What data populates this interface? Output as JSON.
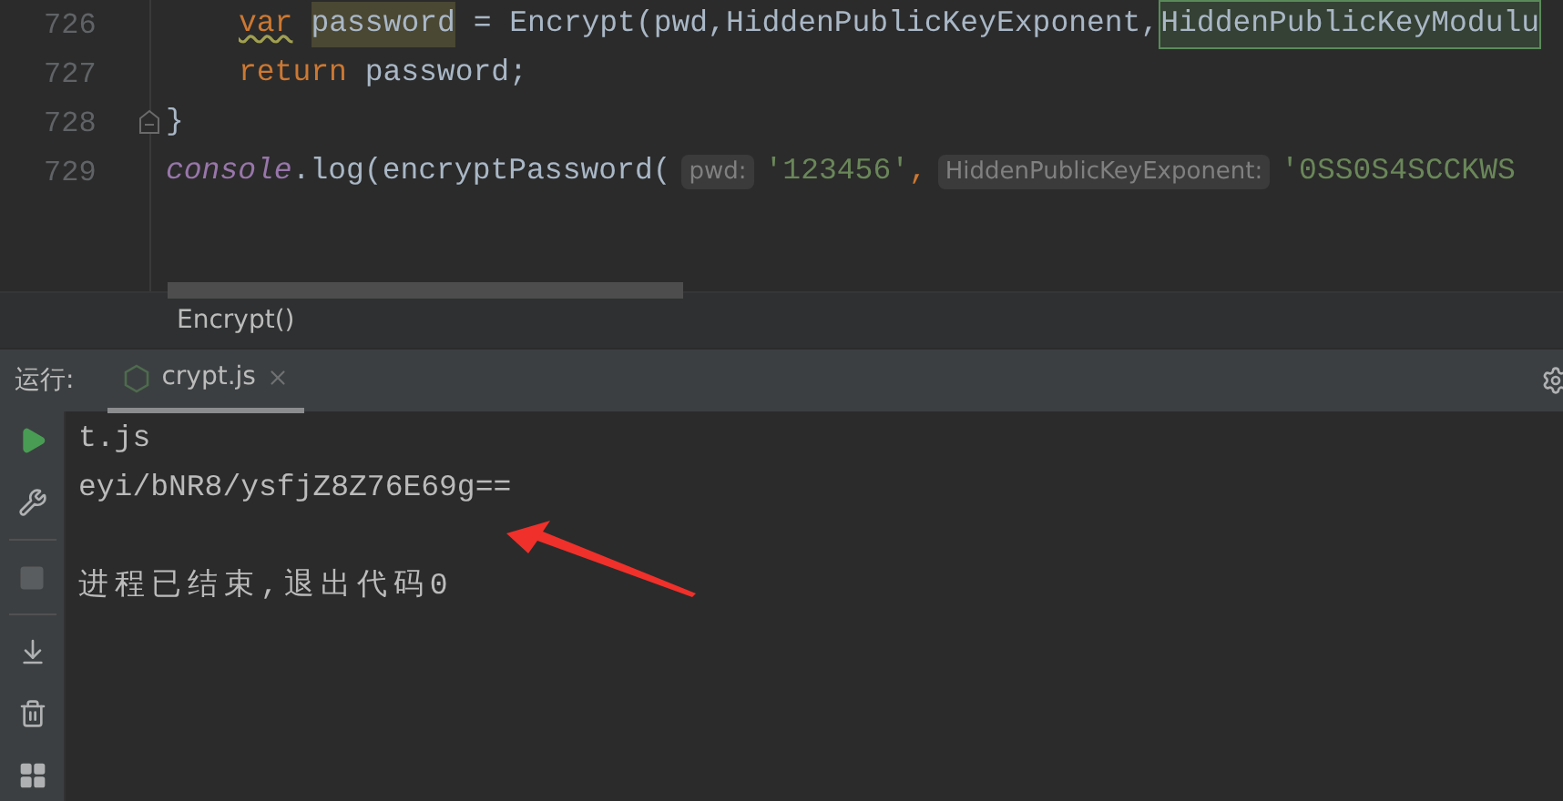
{
  "editor": {
    "lines": [
      {
        "number": "726",
        "indented": true,
        "fold_marker": false,
        "tokens": [
          {
            "kind": "keyword-warn",
            "text": "var"
          },
          {
            "kind": "usage",
            "text": "password"
          },
          {
            "kind": "plain",
            "text": " = Encrypt(pwd,HiddenPublicKeyExponent,"
          },
          {
            "kind": "match",
            "text": "HiddenPublicKeyModulu"
          }
        ]
      },
      {
        "number": "727",
        "indented": true,
        "fold_marker": false,
        "tokens": [
          {
            "kind": "keyword",
            "text": "return"
          },
          {
            "kind": "plain",
            "text": " password;"
          }
        ]
      },
      {
        "number": "728",
        "indented": false,
        "fold_marker": true,
        "tokens": [
          {
            "kind": "plain",
            "text": "}"
          }
        ]
      },
      {
        "number": "729",
        "indented": false,
        "fold_marker": false,
        "tokens": [
          {
            "kind": "global",
            "text": "console"
          },
          {
            "kind": "plain",
            "text": ".log(encryptPassword("
          },
          {
            "kind": "hint",
            "text": "pwd:"
          },
          {
            "kind": "string",
            "text": "'123456'"
          },
          {
            "kind": "keyword",
            "text": ","
          },
          {
            "kind": "hint",
            "text": "HiddenPublicKeyExponent:"
          },
          {
            "kind": "string",
            "text": "'0SS0S4SCCKWS"
          }
        ]
      }
    ]
  },
  "breadcrumb": "Encrypt()",
  "run_panel": {
    "label": "运行:",
    "tabs": [
      {
        "label": "crypt.js",
        "selected": true
      }
    ],
    "toolbar": [
      {
        "kind": "run",
        "disabled": false
      },
      {
        "kind": "settings",
        "disabled": false
      },
      {
        "kind": "stop",
        "disabled": true
      },
      {
        "kind": "scroll-end",
        "disabled": false
      },
      {
        "kind": "delete",
        "disabled": false
      },
      {
        "kind": "layout",
        "disabled": false
      }
    ],
    "console": [
      {
        "kind": "output",
        "text": "t.js"
      },
      {
        "kind": "output",
        "text": "eyi/bNR8/ysfjZ8Z76E69g=="
      },
      {
        "kind": "exit",
        "text": "进程已结束,退出代码0"
      }
    ]
  }
}
